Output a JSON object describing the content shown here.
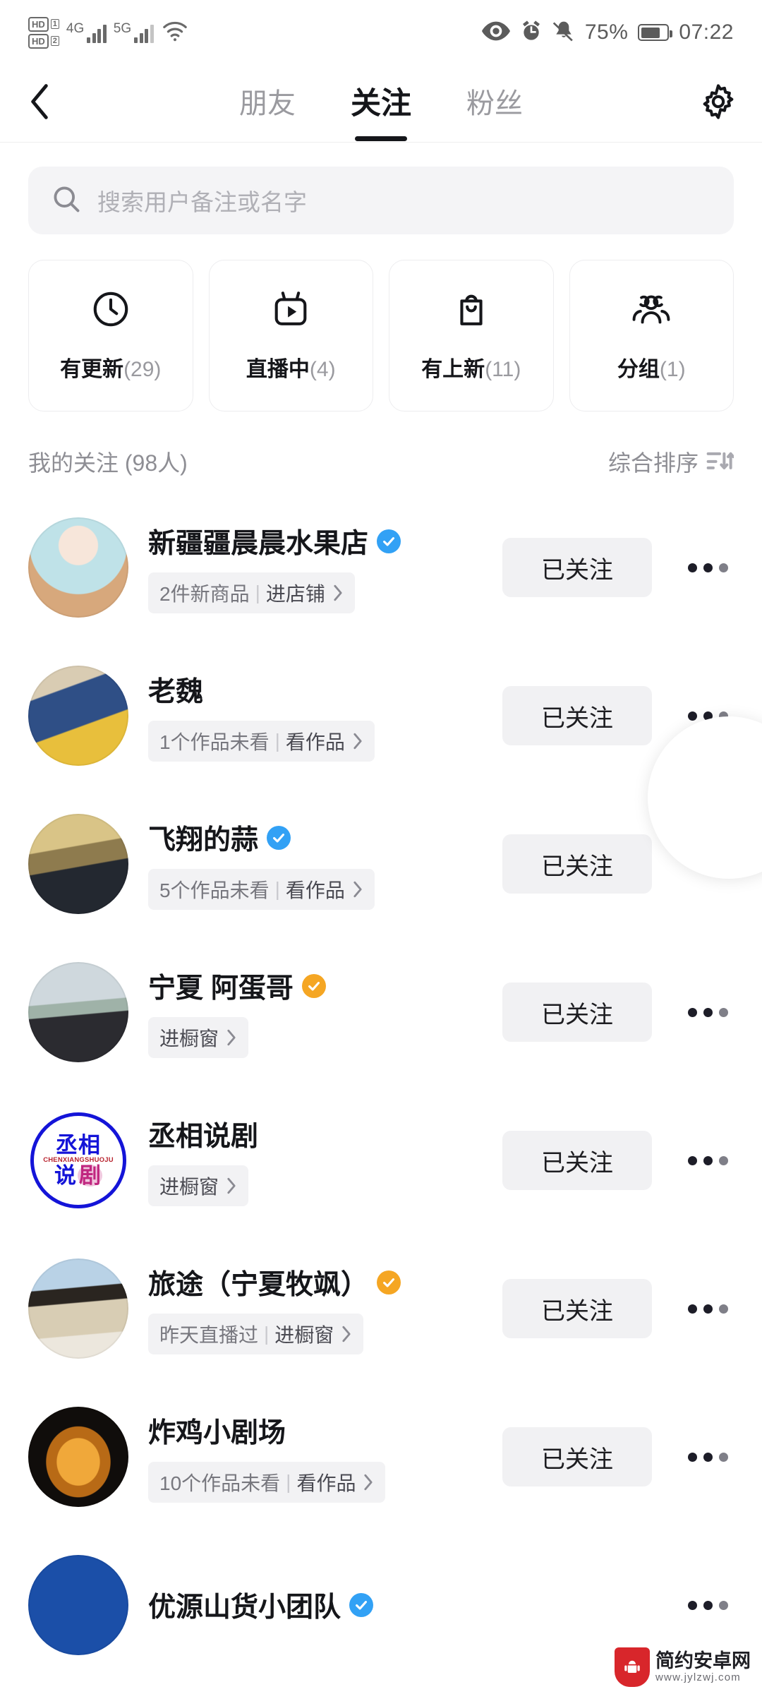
{
  "status_bar": {
    "hd1": "HD",
    "hd1_num": "1",
    "hd2": "HD",
    "hd2_num": "2",
    "net1": "4G",
    "net2": "5G",
    "wifi_icon": "wifi-icon",
    "eye_icon": "eye-icon",
    "alarm_icon": "alarm-clock-icon",
    "mute_icon": "bell-muted-icon",
    "battery_percent": "75%",
    "battery_icon": "battery-icon",
    "time": "07:22"
  },
  "topbar": {
    "back_icon": "back-chevron-icon",
    "settings_icon": "gear-icon",
    "tabs": [
      {
        "label": "朋友",
        "active": false
      },
      {
        "label": "关注",
        "active": true
      },
      {
        "label": "粉丝",
        "active": false
      }
    ]
  },
  "search": {
    "icon": "search-icon",
    "placeholder": "搜索用户备注或名字",
    "value": ""
  },
  "filters": [
    {
      "icon": "clock-icon",
      "label": "有更新",
      "count": "(29)"
    },
    {
      "icon": "live-tv-icon",
      "label": "直播中",
      "count": "(4)"
    },
    {
      "icon": "shopping-bag-icon",
      "label": "有上新",
      "count": "(11)"
    },
    {
      "icon": "group-people-icon",
      "label": "分组",
      "count": "(1)"
    }
  ],
  "list_header": {
    "title": "我的关注 (98人)",
    "sort_label": "综合排序",
    "sort_icon": "sort-icon"
  },
  "users": [
    {
      "name": "新疆疆晨晨水果店",
      "badge": "blue-verified",
      "tag_main": "2件新商品",
      "tag_sep": "|",
      "tag_action": "进店铺",
      "button": "已关注",
      "more_icon": "more-dots-icon",
      "avatar_kind": "photo-fruitshop"
    },
    {
      "name": "老魏",
      "badge": "none",
      "tag_main": "1个作品未看",
      "tag_sep": "|",
      "tag_action": "看作品",
      "button": "已关注",
      "more_icon": "more-dots-icon",
      "avatar_kind": "photo-laowei"
    },
    {
      "name": "飞翔的蒜",
      "badge": "blue-verified",
      "tag_main": "5个作品未看",
      "tag_sep": "|",
      "tag_action": "看作品",
      "button": "已关注",
      "more_icon": "more-dots-icon",
      "avatar_kind": "photo-feixiang"
    },
    {
      "name": "宁夏 阿蛋哥",
      "badge": "orange-verified",
      "tag_main": "",
      "tag_sep": "",
      "tag_action": "进橱窗",
      "button": "已关注",
      "more_icon": "more-dots-icon",
      "avatar_kind": "photo-couple"
    },
    {
      "name": "丞相说剧",
      "badge": "none",
      "tag_main": "",
      "tag_sep": "",
      "tag_action": "进橱窗",
      "button": "已关注",
      "more_icon": "more-dots-icon",
      "avatar_kind": "logo-chengxiang"
    },
    {
      "name": "旅途（宁夏牧飒）",
      "badge": "orange-verified",
      "tag_main": "昨天直播过",
      "tag_sep": "|",
      "tag_action": "进橱窗",
      "button": "已关注",
      "more_icon": "more-dots-icon",
      "avatar_kind": "photo-lvtu"
    },
    {
      "name": "炸鸡小剧场",
      "badge": "none",
      "tag_main": "10个作品未看",
      "tag_sep": "|",
      "tag_action": "看作品",
      "button": "已关注",
      "more_icon": "more-dots-icon",
      "avatar_kind": "photo-chicken"
    },
    {
      "name": "优源山货小团队",
      "badge": "blue-verified",
      "tag_main": "",
      "tag_sep": "",
      "tag_action": "",
      "button": "",
      "more_icon": "more-dots-icon",
      "avatar_kind": "photo-blue"
    }
  ],
  "logo_avatar": {
    "top": "丞相",
    "pinyin": "CHENXIANGSHUOJU",
    "bottom_left": "说",
    "bottom_right": "剧"
  },
  "watermark": {
    "name": "简约安卓网",
    "url": "www.jylzwj.com",
    "icon": "android-shield-icon"
  },
  "colors": {
    "verified_blue": "#32A1F5",
    "verified_orange": "#F5A623",
    "active_text": "#15161A",
    "muted_text": "#9A9A9F",
    "chip_bg": "#F2F2F4",
    "button_bg": "#F1F1F3"
  }
}
